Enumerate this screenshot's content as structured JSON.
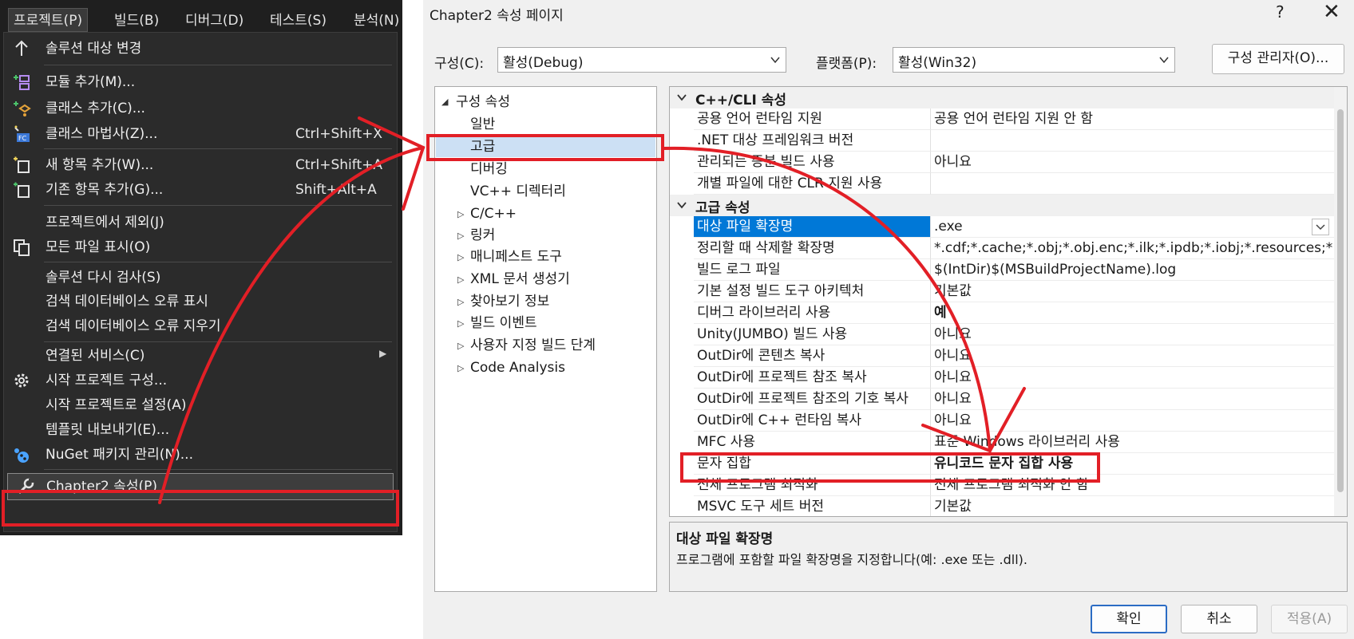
{
  "menubar": {
    "items": [
      "프로젝트(P)",
      "빌드(B)",
      "디버그(D)",
      "테스트(S)",
      "분석(N)"
    ]
  },
  "menu": {
    "items": [
      {
        "label": "솔루션 대상 변경",
        "shortcut": "",
        "icon": "up-arrow-icon"
      },
      {
        "label": "모듈 추가(M)...",
        "shortcut": "",
        "icon": "add-module-icon"
      },
      {
        "label": "클래스 추가(C)...",
        "shortcut": "",
        "icon": "add-class-icon"
      },
      {
        "label": "클래스 마법사(Z)...",
        "shortcut": "Ctrl+Shift+X",
        "icon": "class-wizard-icon"
      },
      {
        "label": "새 항목 추가(W)...",
        "shortcut": "Ctrl+Shift+A",
        "icon": "new-item-icon"
      },
      {
        "label": "기존 항목 추가(G)...",
        "shortcut": "Shift+Alt+A",
        "icon": "existing-item-icon"
      },
      {
        "label": "프로젝트에서 제외(J)",
        "shortcut": "",
        "icon": ""
      },
      {
        "label": "모든 파일 표시(O)",
        "shortcut": "",
        "icon": "show-all-files-icon"
      },
      {
        "label": "솔루션 다시 검사(S)",
        "shortcut": "",
        "icon": ""
      },
      {
        "label": "검색 데이터베이스 오류 표시",
        "shortcut": "",
        "icon": ""
      },
      {
        "label": "검색 데이터베이스 오류 지우기",
        "shortcut": "",
        "icon": ""
      },
      {
        "label": "연결된 서비스(C)",
        "shortcut": "",
        "icon": ""
      },
      {
        "label": "시작 프로젝트 구성...",
        "shortcut": "",
        "icon": "gear-icon"
      },
      {
        "label": "시작 프로젝트로 설정(A)",
        "shortcut": "",
        "icon": ""
      },
      {
        "label": "템플릿 내보내기(E)...",
        "shortcut": "",
        "icon": ""
      },
      {
        "label": "NuGet 패키지 관리(N)...",
        "shortcut": "",
        "icon": "nuget-icon"
      },
      {
        "label": "Chapter2 속성(P)",
        "shortcut": "",
        "icon": "wrench-icon"
      }
    ]
  },
  "dialog": {
    "title": "Chapter2 속성 페이지",
    "help": "?",
    "close": "✕",
    "config_label": "구성(C):",
    "config_value": "활성(Debug)",
    "platform_label": "플랫폼(P):",
    "platform_value": "활성(Win32)",
    "config_manager": "구성 관리자(O)...",
    "ok": "확인",
    "cancel": "취소",
    "apply": "적용(A)"
  },
  "tree": {
    "root": "구성 속성",
    "children": [
      "일반",
      "고급",
      "디버깅",
      "VC++ 디렉터리"
    ],
    "groups": [
      "C/C++",
      "링커",
      "매니페스트 도구",
      "XML 문서 생성기",
      "찾아보기 정보",
      "빌드 이벤트",
      "사용자 지정 빌드 단계",
      "Code Analysis"
    ]
  },
  "grid": {
    "categories": [
      "C++/CLI 속성",
      "고급 속성"
    ],
    "cli_rows": [
      {
        "key": "공용 언어 런타임 지원",
        "value": "공용 언어 런타임 지원 안 함"
      },
      {
        "key": ".NET 대상 프레임워크 버전",
        "value": ""
      },
      {
        "key": "관리되는 증분 빌드 사용",
        "value": "아니요"
      },
      {
        "key": "개별 파일에 대한 CLR 지원 사용",
        "value": ""
      }
    ],
    "adv_rows": [
      {
        "key": "대상 파일 확장명",
        "value": ".exe"
      },
      {
        "key": "정리할 때 삭제할 확장명",
        "value": "*.cdf;*.cache;*.obj;*.obj.enc;*.ilk;*.ipdb;*.iobj;*.resources;*.tlb;*"
      },
      {
        "key": "빌드 로그 파일",
        "value": "$(IntDir)$(MSBuildProjectName).log"
      },
      {
        "key": "기본 설정 빌드 도구 아키텍처",
        "value": "기본값"
      },
      {
        "key": "디버그 라이브러리 사용",
        "value": "예"
      },
      {
        "key": "Unity(JUMBO) 빌드 사용",
        "value": "아니요"
      },
      {
        "key": "OutDir에 콘텐츠 복사",
        "value": "아니요"
      },
      {
        "key": "OutDir에 프로젝트 참조 복사",
        "value": "아니요"
      },
      {
        "key": "OutDir에 프로젝트 참조의 기호 복사",
        "value": "아니요"
      },
      {
        "key": "OutDir에 C++ 런타임 복사",
        "value": "아니요"
      },
      {
        "key": "MFC 사용",
        "value": "표준 Windows 라이브러리 사용"
      },
      {
        "key": "문자 집합",
        "value": "유니코드 문자 집합 사용"
      },
      {
        "key": "전체 프로그램 최적화",
        "value": "전체 프로그램 최적화 안 함"
      },
      {
        "key": "MSVC 도구 세트 버전",
        "value": "기본값"
      }
    ]
  },
  "description": {
    "title": "대상 파일 확장명",
    "text": "프로그램에 포함할 파일 확장명을 지정합니다(예: .exe 또는 .dll)."
  },
  "annotation_color": "#e21f26",
  "selection_color": "#0078d7"
}
